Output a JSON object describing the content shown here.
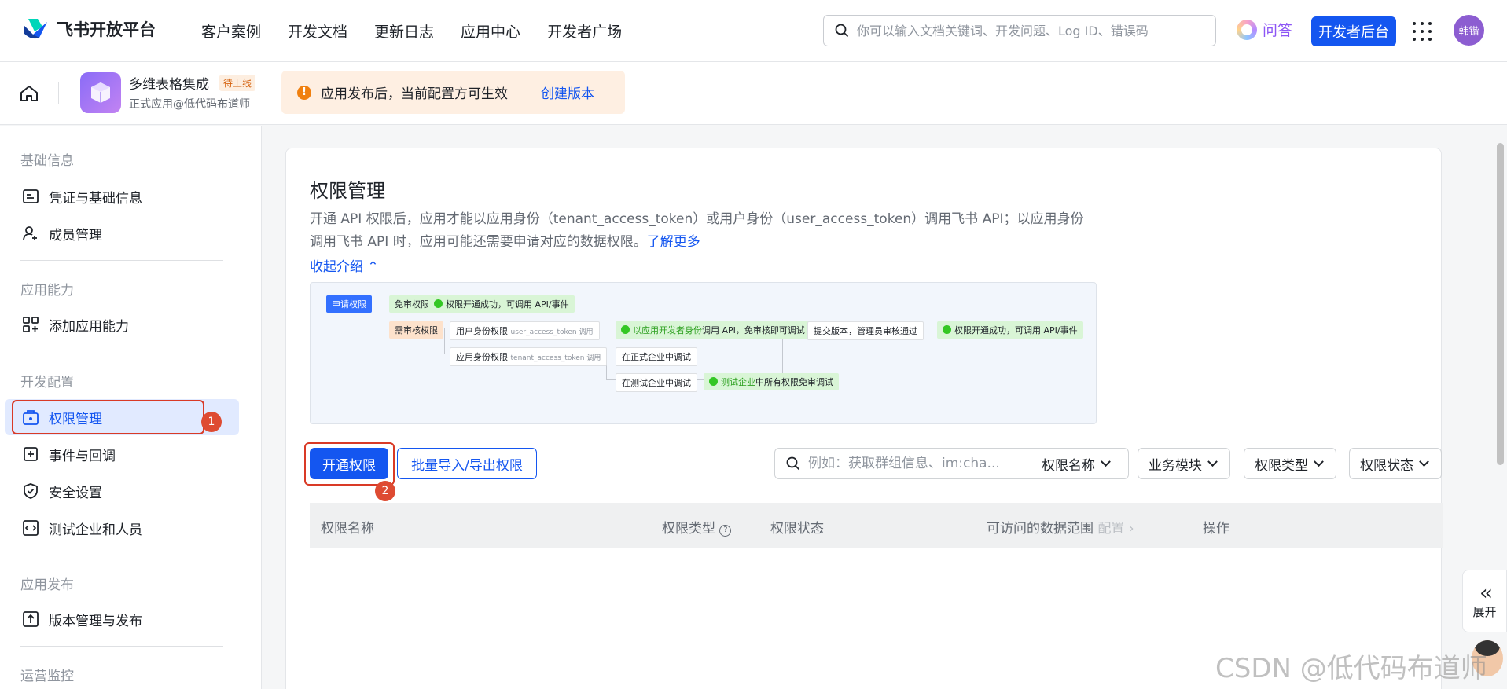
{
  "topbar": {
    "logo_text": "飞书开放平台",
    "nav": [
      "客户案例",
      "开发文档",
      "更新日志",
      "应用中心",
      "开发者广场"
    ],
    "search_placeholder": "你可以输入文档关键词、开发问题、Log ID、错误码",
    "ask_label": "问答",
    "dev_console_label": "开发者后台",
    "avatar_text": "韩锴"
  },
  "subbar": {
    "app_name": "多维表格集成",
    "app_tag": "待上线",
    "app_sub": "正式应用@低代码布道师",
    "notice_text": "应用发布后，当前配置方可生效",
    "notice_link": "创建版本"
  },
  "sidebar": {
    "groups": {
      "basic": "基础信息",
      "capability": "应用能力",
      "dev_config": "开发配置",
      "release": "应用发布",
      "ops": "运营监控"
    },
    "items": {
      "credentials": "凭证与基础信息",
      "members": "成员管理",
      "add_capability": "添加应用能力",
      "permissions": "权限管理",
      "events": "事件与回调",
      "security": "安全设置",
      "test_tenant": "测试企业和人员",
      "versions": "版本管理与发布"
    },
    "annotation_1": "1"
  },
  "main": {
    "title": "权限管理",
    "desc_part1": "开通 API 权限后，应用才能以应用身份（tenant_access_token）或用户身份（user_access_token）调用飞书 API；以应用身份调用飞书 API 时，应用可能还需要申请对应的数据权限。",
    "learn_more": "了解更多",
    "collapse_label": "收起介绍",
    "flow": {
      "apply": "申请权限",
      "no_review": "免审权限",
      "success1": "权限开通成功，可调用 API/事件",
      "need_review": "需审核权限",
      "user_perm": "用户身份权限",
      "user_token": "user_access_token 调用",
      "dev_call_prefix": "以应用开发者身份",
      "dev_call_suffix": "调用 API，免审核即可调试",
      "submit": "提交版本，管理员审核通过",
      "success2": "权限开通成功，可调用 API/事件",
      "app_perm": "应用身份权限",
      "tenant_token": "tenant_access_token 调用",
      "formal_debug": "在正式企业中调试",
      "test_debug": "在测试企业中调试",
      "test_all_prefix": "测试企业",
      "test_all_suffix": "中所有权限免审调试"
    },
    "open_btn": "开通权限",
    "batch_btn": "批量导入/导出权限",
    "annotation_2": "2",
    "search_placeholder": "例如：获取群组信息、im:cha...",
    "filters": {
      "name": "权限名称",
      "module": "业务模块",
      "type": "权限类型",
      "status": "权限状态"
    },
    "table_headers": {
      "name": "权限名称",
      "type": "权限类型",
      "status": "权限状态",
      "scope": "可访问的数据范围",
      "scope_config": "配置",
      "ops": "操作"
    }
  },
  "expand_label": "展开",
  "watermark": "CSDN @低代码布道师"
}
